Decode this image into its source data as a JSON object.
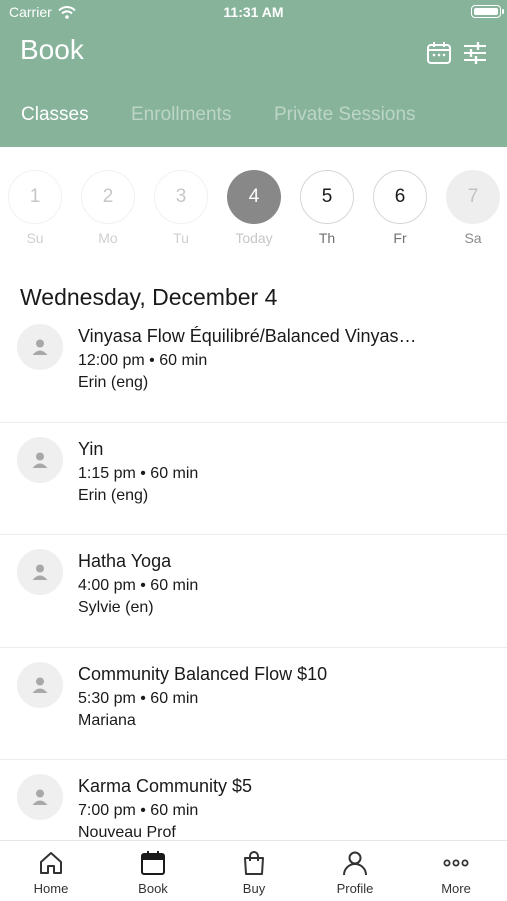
{
  "status_bar": {
    "carrier": "Carrier",
    "time": "11:31 AM"
  },
  "header": {
    "title": "Book",
    "calendar_icon": "calendar-icon",
    "filter_icon": "sliders-icon"
  },
  "tabs": [
    {
      "label": "Classes",
      "active": true
    },
    {
      "label": "Enrollments",
      "active": false
    },
    {
      "label": "Private Sessions",
      "active": false
    }
  ],
  "days": [
    {
      "number": "1",
      "label": "Su"
    },
    {
      "number": "2",
      "label": "Mo"
    },
    {
      "number": "3",
      "label": "Tu"
    },
    {
      "number": "4",
      "label": "Today"
    },
    {
      "number": "5",
      "label": "Th"
    },
    {
      "number": "6",
      "label": "Fr"
    },
    {
      "number": "7",
      "label": "Sa"
    }
  ],
  "date_heading": "Wednesday, December 4",
  "classes": [
    {
      "name": "Vinyasa Flow Équilibré/Balanced Vinyas…",
      "time": "12:00 pm • 60 min",
      "instructor": "Erin (eng)"
    },
    {
      "name": "Yin",
      "time": "1:15 pm • 60 min",
      "instructor": "Erin (eng)"
    },
    {
      "name": "Hatha Yoga",
      "time": "4:00 pm • 60 min",
      "instructor": "Sylvie (en)"
    },
    {
      "name": "Community Balanced Flow $10",
      "time": "5:30 pm • 60 min",
      "instructor": "Mariana"
    },
    {
      "name": "Karma Community $5",
      "time": "7:00 pm • 60 min",
      "instructor": "Nouveau Prof"
    }
  ],
  "bottom_nav": [
    {
      "label": "Home",
      "icon": "home-icon"
    },
    {
      "label": "Book",
      "icon": "calendar-icon"
    },
    {
      "label": "Buy",
      "icon": "shopping-bag-icon"
    },
    {
      "label": "Profile",
      "icon": "person-icon"
    },
    {
      "label": "More",
      "icon": "more-icon"
    }
  ],
  "colors": {
    "header": "#86b39a",
    "today": "#888888"
  }
}
